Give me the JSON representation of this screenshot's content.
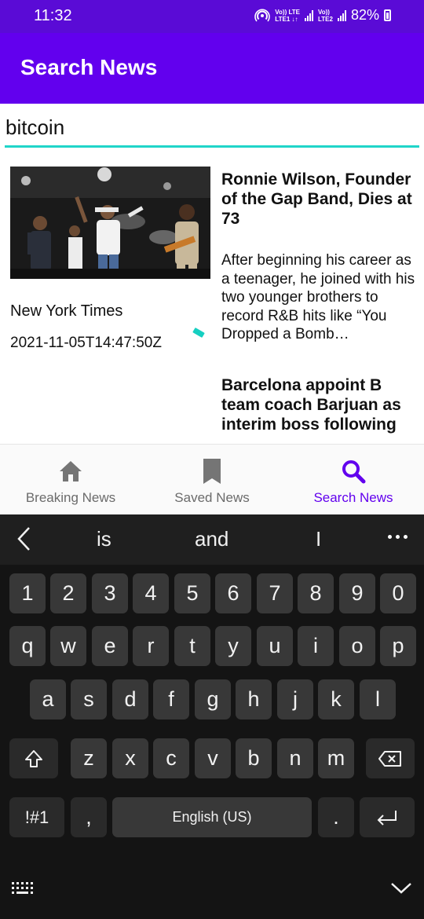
{
  "status_bar": {
    "time": "11:32",
    "lte1_top": "Vo)) LTE",
    "lte1_bottom": "LTE1 ↓↑",
    "lte2_top": "Vo))",
    "lte2_bottom": "LTE2",
    "battery": "82%"
  },
  "app_bar": {
    "title": "Search News"
  },
  "search": {
    "value": "bitcoin"
  },
  "articles": [
    {
      "source": "New York Times",
      "published": "2021-11-05T14:47:50Z",
      "title": "Ronnie Wilson, Founder of the Gap Band, Dies at 73",
      "description": "After beginning his career as a teenager, he joined with his two younger brothers to record R&B hits like “You Dropped a Bomb…"
    },
    {
      "title": "Barcelona appoint B team coach Barjuan as interim boss following …"
    }
  ],
  "bottom_nav": [
    {
      "label": "Breaking News",
      "icon": "home-icon"
    },
    {
      "label": "Saved News",
      "icon": "bookmark-icon"
    },
    {
      "label": "Search News",
      "icon": "search-icon",
      "active": true
    }
  ],
  "keyboard": {
    "suggestions": [
      "is",
      "and",
      "I"
    ],
    "rows": [
      [
        "1",
        "2",
        "3",
        "4",
        "5",
        "6",
        "7",
        "8",
        "9",
        "0"
      ],
      [
        "q",
        "w",
        "e",
        "r",
        "t",
        "y",
        "u",
        "i",
        "o",
        "p"
      ],
      [
        "a",
        "s",
        "d",
        "f",
        "g",
        "h",
        "j",
        "k",
        "l"
      ],
      [
        "z",
        "x",
        "c",
        "v",
        "b",
        "n",
        "m"
      ]
    ],
    "symbols_label": "!#1",
    "comma": ",",
    "space_label": "English (US)",
    "period": "."
  },
  "colors": {
    "status_bar": "#5a0bd6",
    "app_bar": "#6200ee",
    "accent": "#20d5c9",
    "active_nav": "#6200ee"
  }
}
